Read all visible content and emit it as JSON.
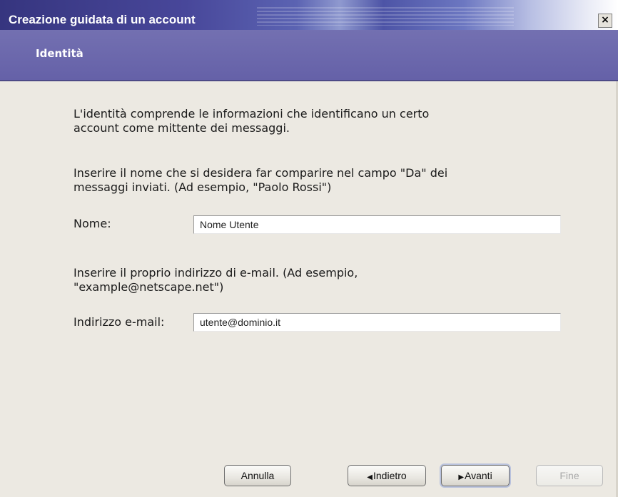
{
  "window": {
    "title": "Creazione guidata di un account",
    "close_glyph": "×"
  },
  "header": {
    "title": "Identità"
  },
  "content": {
    "intro": "L'identità comprende le informazioni che identificano un certo\naccount come mittente dei messaggi.",
    "name_instructions": "Inserire il nome che si desidera far comparire nel campo \"Da\" dei\nmessaggi inviati. (Ad esempio, \"Paolo Rossi\")",
    "name_label": "Nome:",
    "name_value": "Nome Utente",
    "email_instructions": "Inserire il proprio indirizzo di e-mail. (Ad esempio,\n\"example@netscape.net\")",
    "email_label": "Indirizzo e-mail:",
    "email_value": "utente@dominio.it"
  },
  "buttons": {
    "cancel": "Annulla",
    "back": "Indietro",
    "next": "Avanti",
    "finish": "Fine",
    "back_arrow": "◀",
    "next_arrow": "▶"
  },
  "icons": [
    "close-icon",
    "back-arrow-icon",
    "next-arrow-icon"
  ]
}
